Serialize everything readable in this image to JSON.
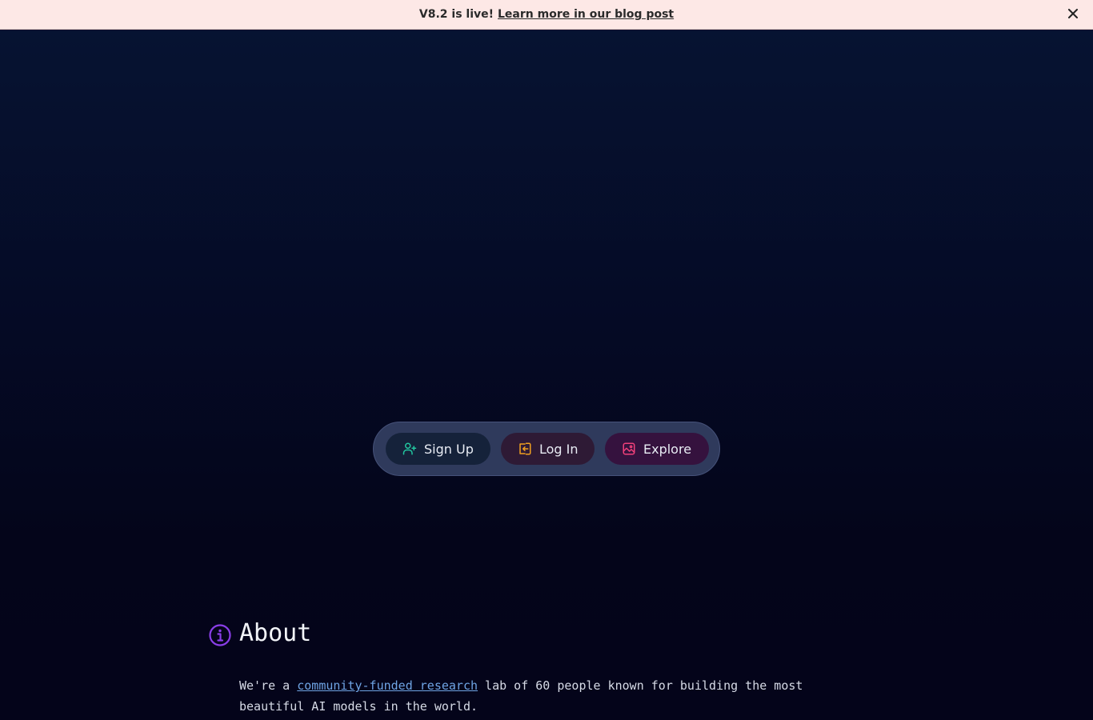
{
  "banner": {
    "version_text": "V8.2 is live!",
    "link_text": "Learn more in our blog post",
    "close_label": "✕"
  },
  "actions": {
    "signup_label": "Sign Up",
    "login_label": "Log In",
    "explore_label": "Explore",
    "signup_color": "#22c7a0",
    "login_color": "#f0a020",
    "explore_color": "#f0407a"
  },
  "about": {
    "title": "About",
    "text_before": "We're a ",
    "link_text": "community-funded research",
    "text_after": " lab of 60 people known for building the most beautiful AI models in the world.",
    "icon": "info-icon",
    "icon_color": "#8a3ee8"
  }
}
